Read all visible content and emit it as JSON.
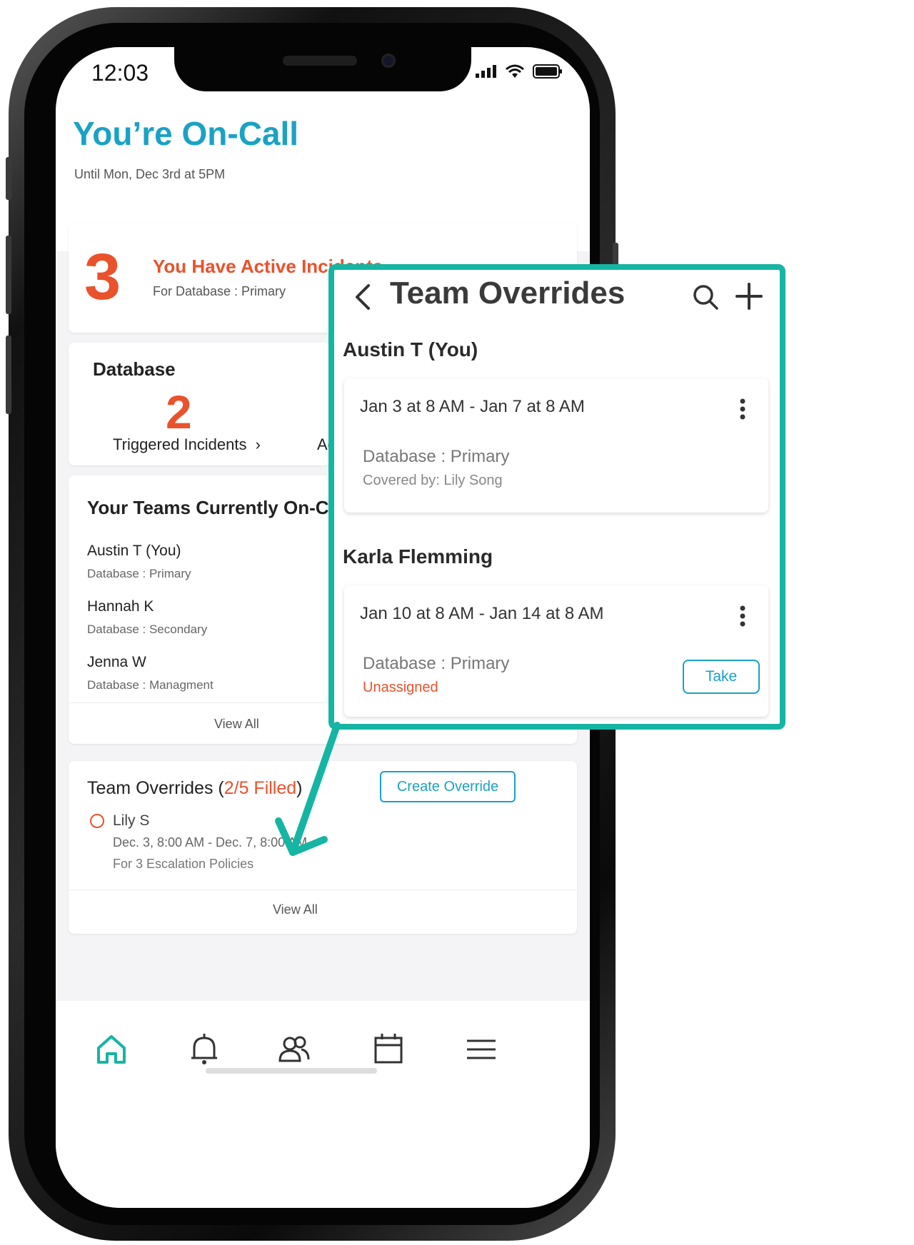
{
  "status_bar": {
    "time": "12:03"
  },
  "header": {
    "title": "You’re On-Call",
    "subtitle": "Until Mon, Dec 3rd at 5PM"
  },
  "incidents": {
    "count": "3",
    "title": "You Have Active Incidents",
    "subtitle": "For Database : Primary"
  },
  "database": {
    "title": "Database",
    "triggered_count": "2",
    "triggered_label": "Triggered Incidents",
    "chevron": "›",
    "ack_label": "Ack"
  },
  "teams": {
    "title": "Your Teams Currently On-Call",
    "members": [
      {
        "name": "Austin T (You)",
        "role": "Database : Primary"
      },
      {
        "name": "Hannah K",
        "role": "Database : Secondary"
      },
      {
        "name": "Jenna W",
        "role": "Database : Managment"
      }
    ],
    "view_all": "View All"
  },
  "overrides_card": {
    "title_prefix": "Team Overrides (",
    "filled": "2/5 Filled",
    "title_suffix": ")",
    "create_button": "Create Override",
    "item": {
      "name": "Lily S",
      "dates": "Dec. 3, 8:00 AM - Dec. 7, 8:00 AM",
      "policies": "For 3 Escalation Policies"
    },
    "view_all": "View All"
  },
  "tab_bar": {
    "icons": [
      "home-icon",
      "bell-icon",
      "users-icon",
      "calendar-icon",
      "menu-icon"
    ],
    "active": "home-icon"
  },
  "panel": {
    "title": "Team Overrides",
    "sections": [
      {
        "name": "Austin T (You)",
        "range": "Jan 3 at 8 AM - Jan 7 at 8 AM",
        "database": "Database : Primary",
        "coverage": "Covered by: Lily Song"
      },
      {
        "name": "Karla Flemming",
        "range": "Jan 10 at 8 AM - Jan 14 at 8 AM",
        "database": "Database : Primary",
        "status": "Unassigned",
        "take_button": "Take"
      }
    ]
  },
  "colors": {
    "brand_blue": "#1aa2c4",
    "alert_orange": "#e9522c",
    "panel_teal": "#16b5a3"
  }
}
